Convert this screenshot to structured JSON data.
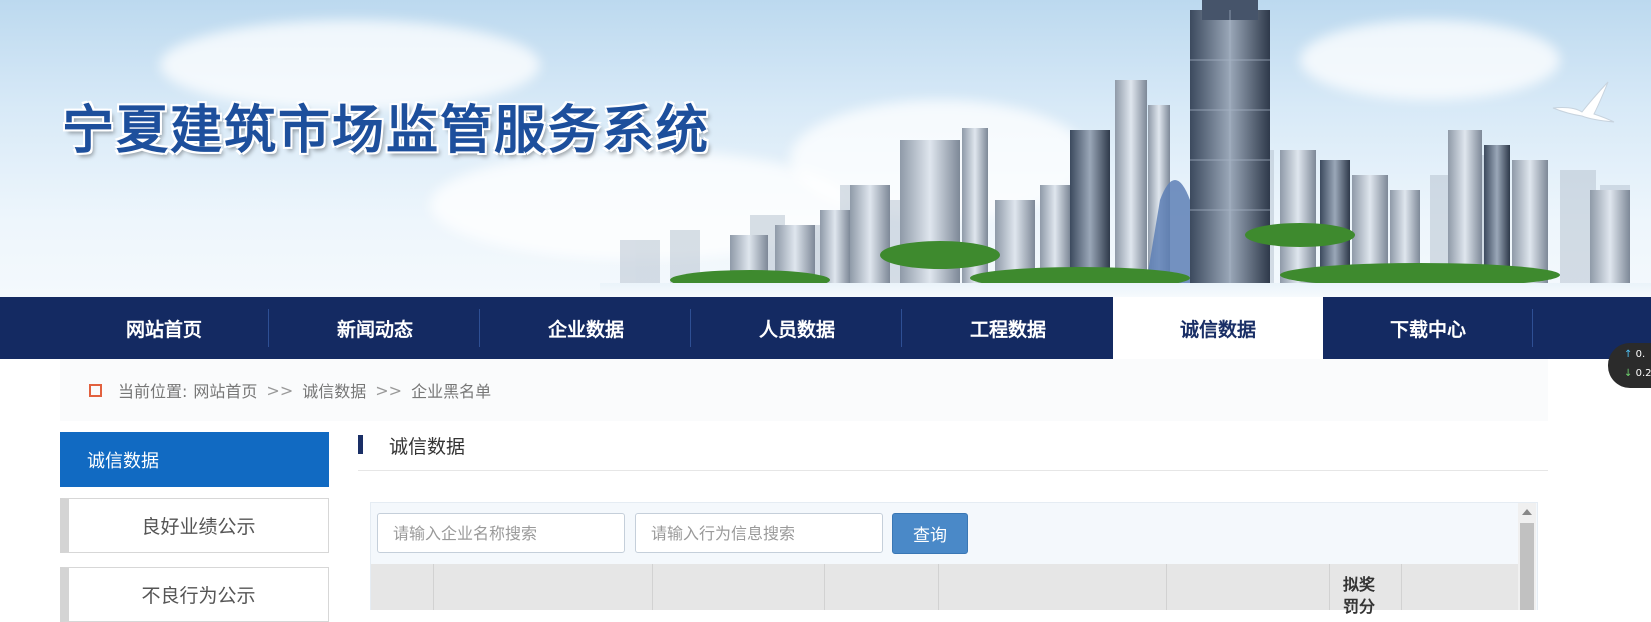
{
  "banner": {
    "site_title": "宁夏建筑市场监管服务系统"
  },
  "nav": {
    "items": [
      {
        "label": "网站首页"
      },
      {
        "label": "新闻动态"
      },
      {
        "label": "企业数据"
      },
      {
        "label": "人员数据"
      },
      {
        "label": "工程数据"
      },
      {
        "label": "诚信数据",
        "active": true
      },
      {
        "label": "下载中心"
      }
    ]
  },
  "speed_widget": {
    "up": "0.",
    "down": "0.2"
  },
  "breadcrumb": {
    "prefix": "当前位置:",
    "items": [
      "网站首页",
      "诚信数据",
      "企业黑名单"
    ],
    "separator": ">>"
  },
  "sidebar": {
    "heading": "诚信数据",
    "items": [
      {
        "label": "良好业绩公示"
      },
      {
        "label": "不良行为公示"
      }
    ]
  },
  "content": {
    "section_title": "诚信数据",
    "search": {
      "company_placeholder": "请输入企业名称搜索",
      "behavior_placeholder": "请输入行为信息搜索",
      "company_value": "",
      "behavior_value": "",
      "query_label": "查询"
    },
    "table": {
      "visible_header_text": "拟奖罚分"
    }
  },
  "colors": {
    "nav_bg": "#142a62",
    "sidebar_heading_bg": "#116ac2",
    "query_button_bg": "#4a89c8",
    "title_blue": "#1d4f9c"
  }
}
